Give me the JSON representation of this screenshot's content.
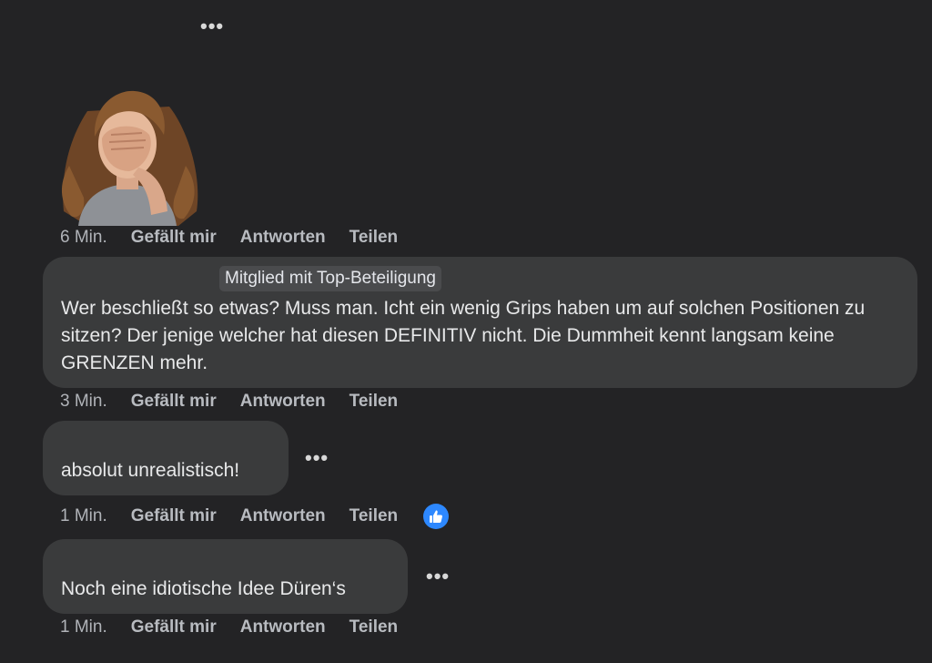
{
  "top_more": "•••",
  "sticker": {
    "name": "facepalm-avatar-sticker"
  },
  "comments": [
    {
      "time": "6 Min.",
      "like": "Gefällt mir",
      "reply": "Antworten",
      "share": "Teilen"
    },
    {
      "badge": "Mitglied mit Top-Beteiligung",
      "text": "Wer beschließt so etwas? Muss man. Icht ein wenig Grips haben um auf solchen Positionen zu sitzen? Der jenige welcher hat diesen DEFINITIV nicht. Die Dummheit kennt langsam keine GRENZEN mehr.",
      "time": "3 Min.",
      "like": "Gefällt mir",
      "reply": "Antworten",
      "share": "Teilen"
    },
    {
      "text": "absolut unrealistisch!",
      "more": "•••",
      "time": "1 Min.",
      "like": "Gefällt mir",
      "reply": "Antworten",
      "share": "Teilen",
      "reaction": "like"
    },
    {
      "text": "Noch eine idiotische Idee Düren‘s",
      "more": "•••",
      "time": "1 Min.",
      "like": "Gefällt mir",
      "reply": "Antworten",
      "share": "Teilen"
    }
  ],
  "colors": {
    "background": "#232325",
    "bubble": "#3a3b3c",
    "like_blue": "#2d88ff"
  }
}
